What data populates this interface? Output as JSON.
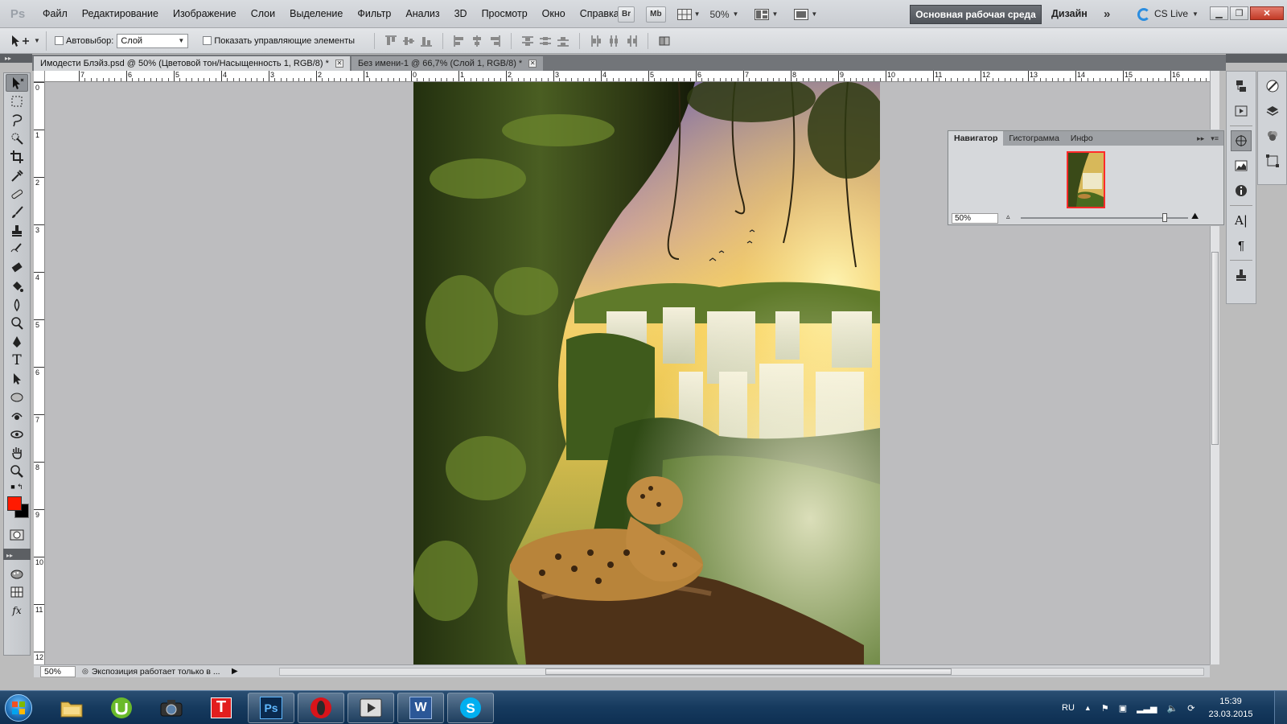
{
  "app": {
    "logo": "Ps"
  },
  "menu": [
    "Файл",
    "Редактирование",
    "Изображение",
    "Слои",
    "Выделение",
    "Фильтр",
    "Анализ",
    "3D",
    "Просмотр",
    "Окно",
    "Справка"
  ],
  "appbar": {
    "br_label": "Br",
    "mb_label": "Mb",
    "zoom_value": "50%",
    "workspace_active": "Основная рабочая среда",
    "workspace_design": "Дизайн",
    "more_label": "»",
    "cslive_label": "CS Live"
  },
  "options": {
    "autoselect_label": "Автовыбор:",
    "autoselect_value": "Слой",
    "show_controls_label": "Показать управляющие элементы"
  },
  "tabs": [
    {
      "label": "Имодести Блэйз.psd @ 50% (Цветовой тон/Насыщенность 1, RGB/8) *",
      "active": true
    },
    {
      "label": "Без имени-1 @ 66,7% (Слой 1, RGB/8) *",
      "active": false
    }
  ],
  "ruler_h": [
    "7",
    "6",
    "5",
    "4",
    "3",
    "2",
    "1",
    "0",
    "1",
    "2",
    "3",
    "4",
    "5",
    "6",
    "7",
    "8",
    "9",
    "10",
    "11",
    "12",
    "13",
    "14",
    "15",
    "16"
  ],
  "ruler_v": [
    "0",
    "1",
    "2",
    "3",
    "4",
    "5",
    "6",
    "7",
    "8",
    "9",
    "10",
    "11",
    "12"
  ],
  "navigator": {
    "tabs": [
      "Навигатор",
      "Гистограмма",
      "Инфо"
    ],
    "zoom_value": "50%"
  },
  "status": {
    "zoom": "50%",
    "info": "Экспозиция работает только в ..."
  },
  "colors": {
    "foreground": "#ff1a00",
    "background": "#000000",
    "workspace_active_bg": "#5a5e64"
  },
  "taskbar": {
    "language": "RU",
    "time": "15:39",
    "date": "23.03.2015"
  }
}
